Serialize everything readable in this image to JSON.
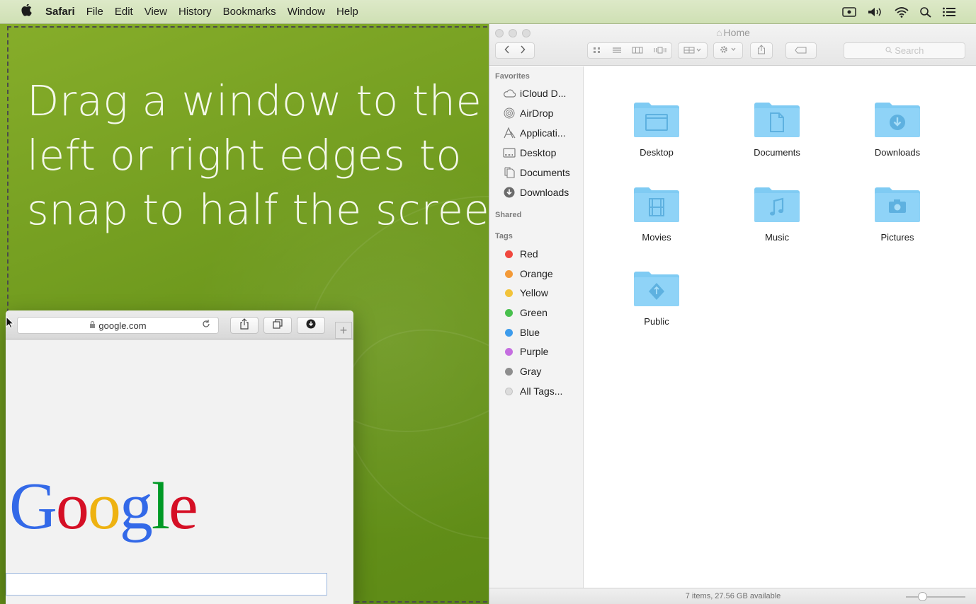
{
  "menubar": {
    "apple_icon": "apple-logo",
    "app_name": "Safari",
    "items": [
      "File",
      "Edit",
      "View",
      "History",
      "Bookmarks",
      "Window",
      "Help"
    ],
    "status_icons": [
      "screen-mirroring-icon",
      "volume-icon",
      "wifi-icon",
      "spotlight-search-icon",
      "notification-center-icon"
    ]
  },
  "desktop": {
    "headline_lines": [
      "Drag a window to the",
      "left or right edges to",
      "snap to half the screen"
    ]
  },
  "safari": {
    "address": "google.com",
    "toolbar_icons": [
      "reload-icon",
      "share-icon",
      "tabs-icon",
      "downloads-icon"
    ],
    "new_tab": "+",
    "logo_letters": [
      "G",
      "o",
      "o",
      "g",
      "l",
      "e"
    ],
    "logo_colors": [
      "#3369e8",
      "#d50f25",
      "#eeb211",
      "#3369e8",
      "#009925",
      "#d50f25"
    ]
  },
  "finder": {
    "title": "Home",
    "search_placeholder": "Search",
    "sidebar": {
      "favorites_heading": "Favorites",
      "favorites": [
        {
          "label": "iCloud D...",
          "icon": "cloud-icon"
        },
        {
          "label": "AirDrop",
          "icon": "airdrop-icon"
        },
        {
          "label": "Applicati...",
          "icon": "applications-icon"
        },
        {
          "label": "Desktop",
          "icon": "desktop-icon"
        },
        {
          "label": "Documents",
          "icon": "documents-icon"
        },
        {
          "label": "Downloads",
          "icon": "downloads-icon"
        }
      ],
      "shared_heading": "Shared",
      "tags_heading": "Tags",
      "tags": [
        {
          "label": "Red",
          "color": "#f0483e"
        },
        {
          "label": "Orange",
          "color": "#f39a38"
        },
        {
          "label": "Yellow",
          "color": "#f2c33a"
        },
        {
          "label": "Green",
          "color": "#48c04d"
        },
        {
          "label": "Blue",
          "color": "#3d9cec"
        },
        {
          "label": "Purple",
          "color": "#c56ee0"
        },
        {
          "label": "Gray",
          "color": "#8e8e8e"
        },
        {
          "label": "All Tags...",
          "color": "#dcdcdc"
        }
      ]
    },
    "folders": [
      {
        "name": "Desktop",
        "glyph": "desktop"
      },
      {
        "name": "Documents",
        "glyph": "document"
      },
      {
        "name": "Downloads",
        "glyph": "download"
      },
      {
        "name": "Movies",
        "glyph": "film"
      },
      {
        "name": "Music",
        "glyph": "note"
      },
      {
        "name": "Pictures",
        "glyph": "camera"
      },
      {
        "name": "Public",
        "glyph": "public"
      }
    ],
    "status": "7 items, 27.56 GB available",
    "folder_color": "#7fcbf3"
  }
}
